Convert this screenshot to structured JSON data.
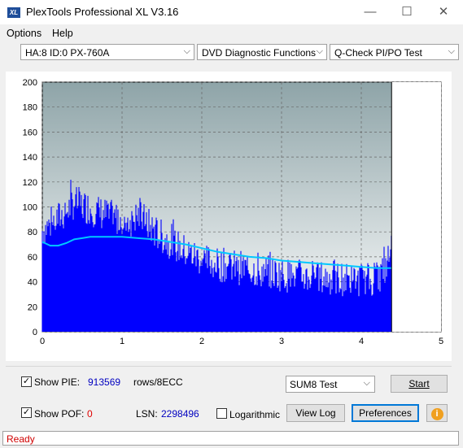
{
  "window": {
    "title": "PlexTools Professional XL V3.16",
    "app_icon_text": "XL",
    "minimize": "—",
    "maximize": "☐",
    "close": "✕"
  },
  "menu": [
    "Options",
    "Help"
  ],
  "toolbar": {
    "drive": "HA:8 ID:0  PX-760A",
    "function": "DVD Diagnostic Functions",
    "test": "Q-Check PI/PO Test"
  },
  "chart_data": {
    "type": "area",
    "x_ticks": [
      "0",
      "1",
      "2",
      "3",
      "4",
      "5"
    ],
    "y_ticks": [
      "200",
      "180",
      "160",
      "140",
      "120",
      "100",
      "80",
      "60",
      "40",
      "20",
      "0"
    ],
    "xlim": [
      0,
      5
    ],
    "ylim": [
      0,
      200
    ],
    "end_marker_x": 4.38,
    "grid": true,
    "colors": {
      "pie": "#0000ff",
      "trend": "#00c8ff",
      "plot_bg_top": "#8ea4a8",
      "plot_bg_bottom": "#ffffff"
    },
    "series": [
      {
        "kind": "bars",
        "x": [
          0.0,
          0.1,
          0.2,
          0.3,
          0.4,
          0.5,
          0.6,
          0.7,
          0.8,
          0.9,
          1.0,
          1.1,
          1.2,
          1.3,
          1.4,
          1.5,
          1.6,
          1.7,
          1.8,
          1.9,
          2.0,
          2.1,
          2.2,
          2.3,
          2.4,
          2.5,
          2.6,
          2.7,
          2.8,
          2.9,
          3.0,
          3.1,
          3.2,
          3.3,
          3.4,
          3.5,
          3.6,
          3.7,
          3.8,
          3.9,
          4.0,
          4.1,
          4.2,
          4.3,
          4.38
        ],
        "y": [
          85,
          90,
          95,
          100,
          108,
          105,
          103,
          100,
          98,
          95,
          95,
          93,
          97,
          92,
          85,
          80,
          76,
          72,
          68,
          65,
          62,
          60,
          58,
          57,
          56,
          55,
          54,
          53,
          52,
          51,
          50,
          49,
          49,
          48,
          48,
          47,
          47,
          47,
          46,
          46,
          46,
          46,
          47,
          55,
          70
        ]
      },
      {
        "kind": "line",
        "x": [
          0.0,
          0.1,
          0.2,
          0.3,
          0.4,
          0.5,
          0.6,
          0.8,
          1.0,
          1.2,
          1.4,
          1.6,
          1.8,
          2.0,
          2.2,
          2.4,
          2.6,
          2.8,
          3.0,
          3.2,
          3.4,
          3.6,
          3.8,
          4.0,
          4.2,
          4.38
        ],
        "y": [
          72,
          69,
          69,
          71,
          74,
          75,
          76,
          76,
          76,
          75,
          74,
          72,
          70,
          67,
          64,
          62,
          60,
          59,
          57,
          56,
          55,
          54,
          53,
          52,
          51,
          51
        ]
      }
    ]
  },
  "controls": {
    "show_pie_label": "Show PIE:",
    "show_pie_checked": true,
    "pie_value": "913569",
    "pie_unit": "rows/8ECC",
    "show_pof_label": "Show POF:",
    "show_pof_checked": true,
    "pof_value": "0",
    "lsn_label": "LSN:",
    "lsn_value": "2298496",
    "logarithmic_label": "Logarithmic",
    "logarithmic_checked": false,
    "sum_select": "SUM8 Test",
    "start": "Start",
    "view_log": "View Log",
    "preferences": "Preferences",
    "info_icon": "i",
    "colors": {
      "value_blue": "#0000c0",
      "pof_red": "#e00000",
      "info_orange": "#f0a020"
    }
  },
  "status": {
    "text": "Ready",
    "color": "#d00000"
  }
}
